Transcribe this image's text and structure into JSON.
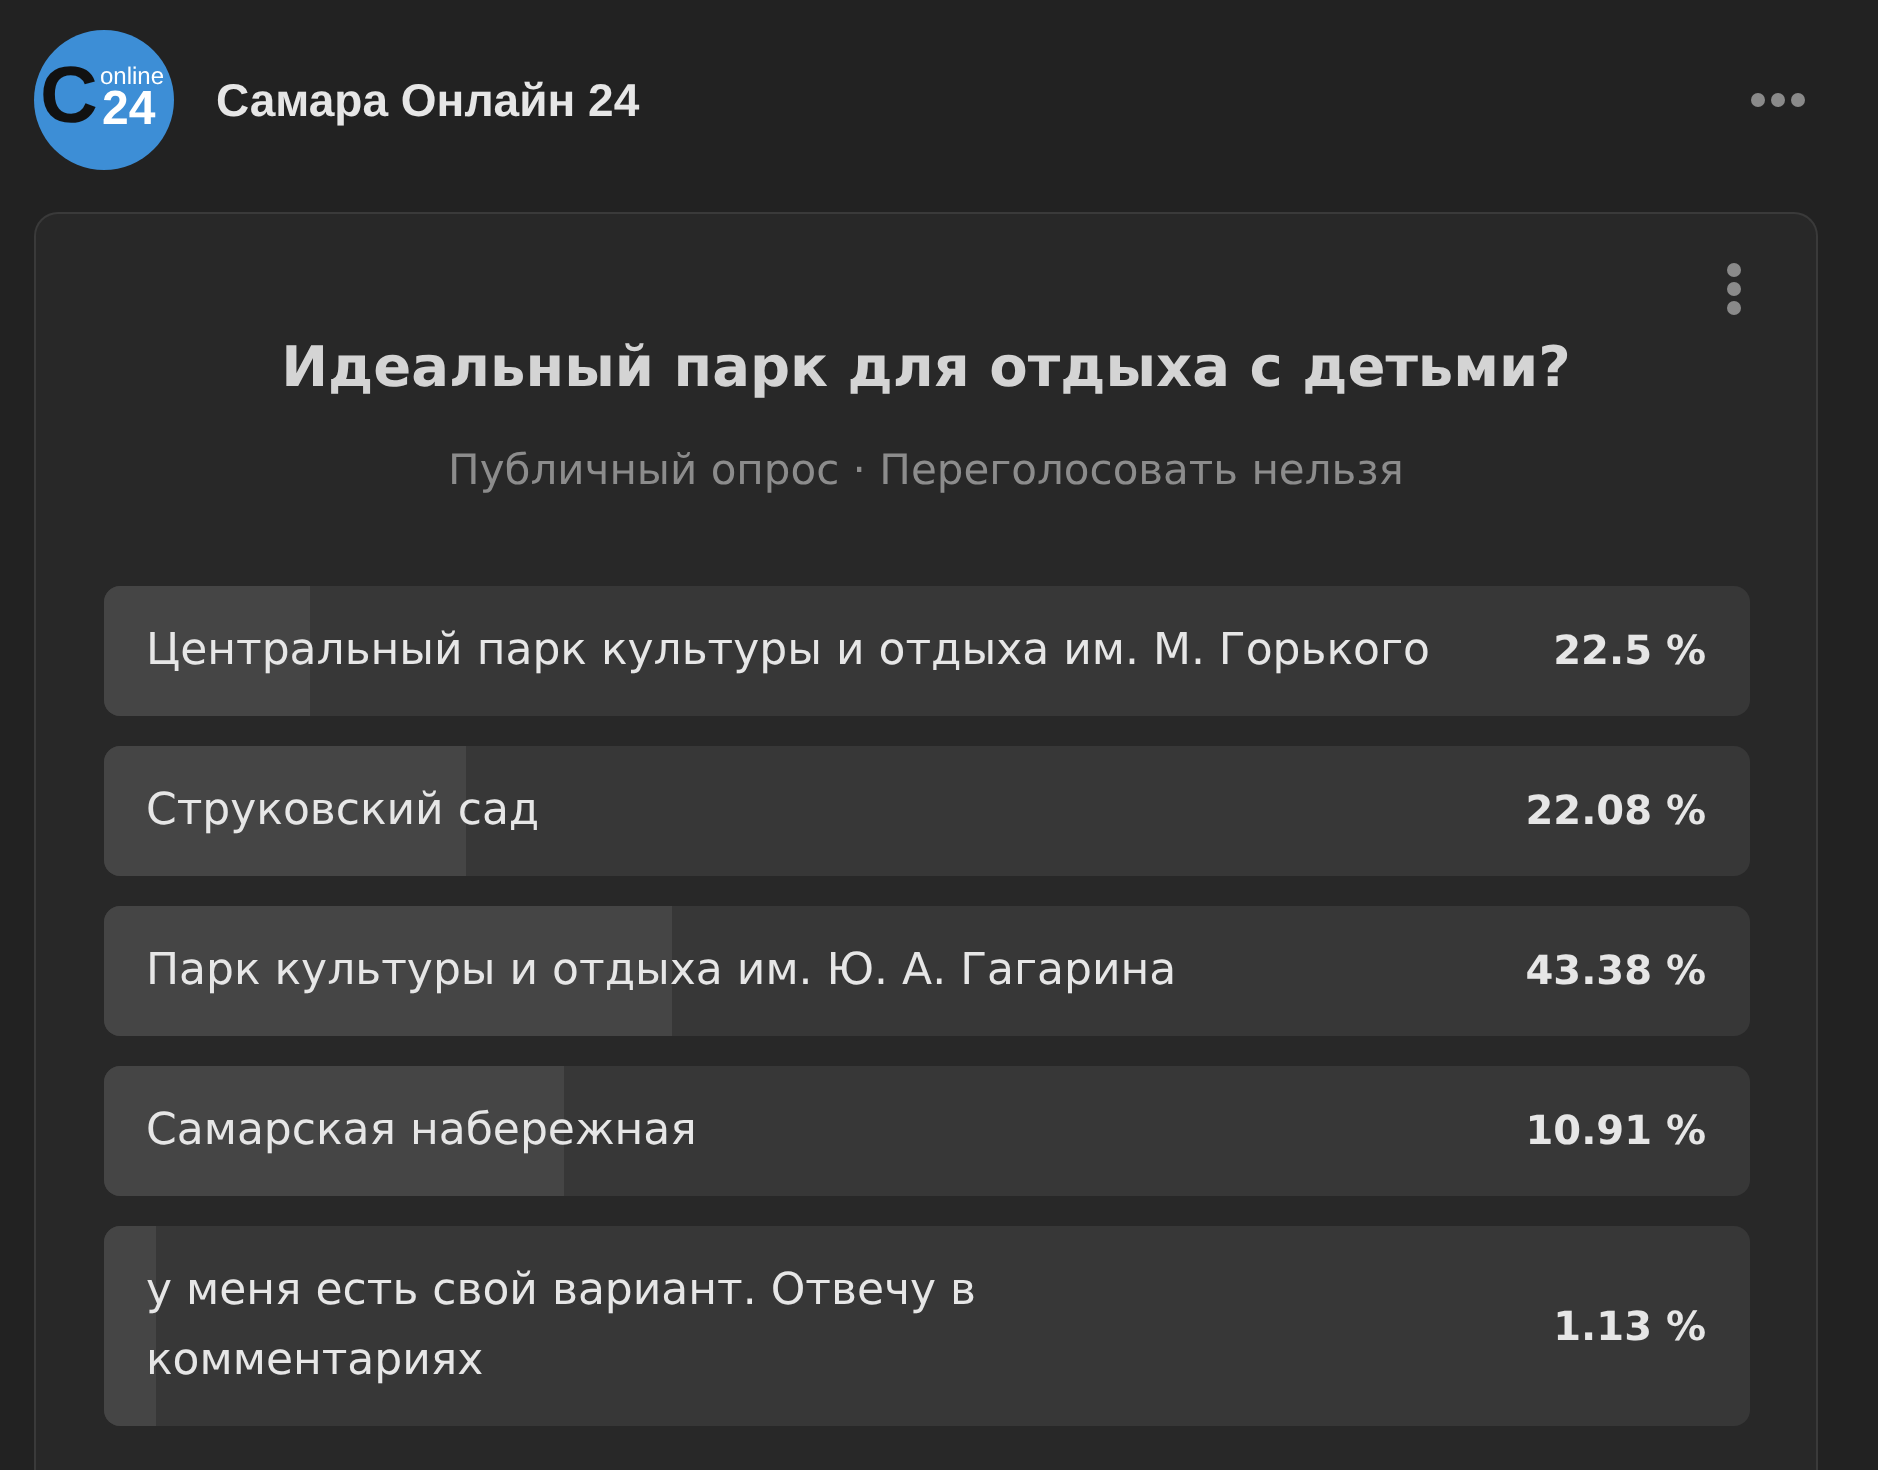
{
  "channel": {
    "logo": {
      "letter": "C",
      "tagline": "online",
      "number": "24"
    },
    "name": "Самара Онлайн 24"
  },
  "poll": {
    "question": "Идеальный парк для отдыха с детьми?",
    "subtitle": "Публичный опрос · Переголосовать нельзя",
    "options": [
      {
        "label": "Центральный парк культуры и отдыха им. М. Горького",
        "percentage": "22.5 %",
        "level": 0.125
      },
      {
        "label": "Струковский сад",
        "percentage": "22.08 %",
        "level": 0.22
      },
      {
        "label": "Парк культуры и отдыха им. Ю. А. Гагарина",
        "percentage": "43.38 %",
        "level": 0.345
      },
      {
        "label": "Самарская набережная",
        "percentage": "10.91 %",
        "level": 0.28
      },
      {
        "label": "у меня есть свой вариант. Отвечу в\nкомментариях",
        "percentage": "1.13 %",
        "level": 0.032
      }
    ]
  }
}
